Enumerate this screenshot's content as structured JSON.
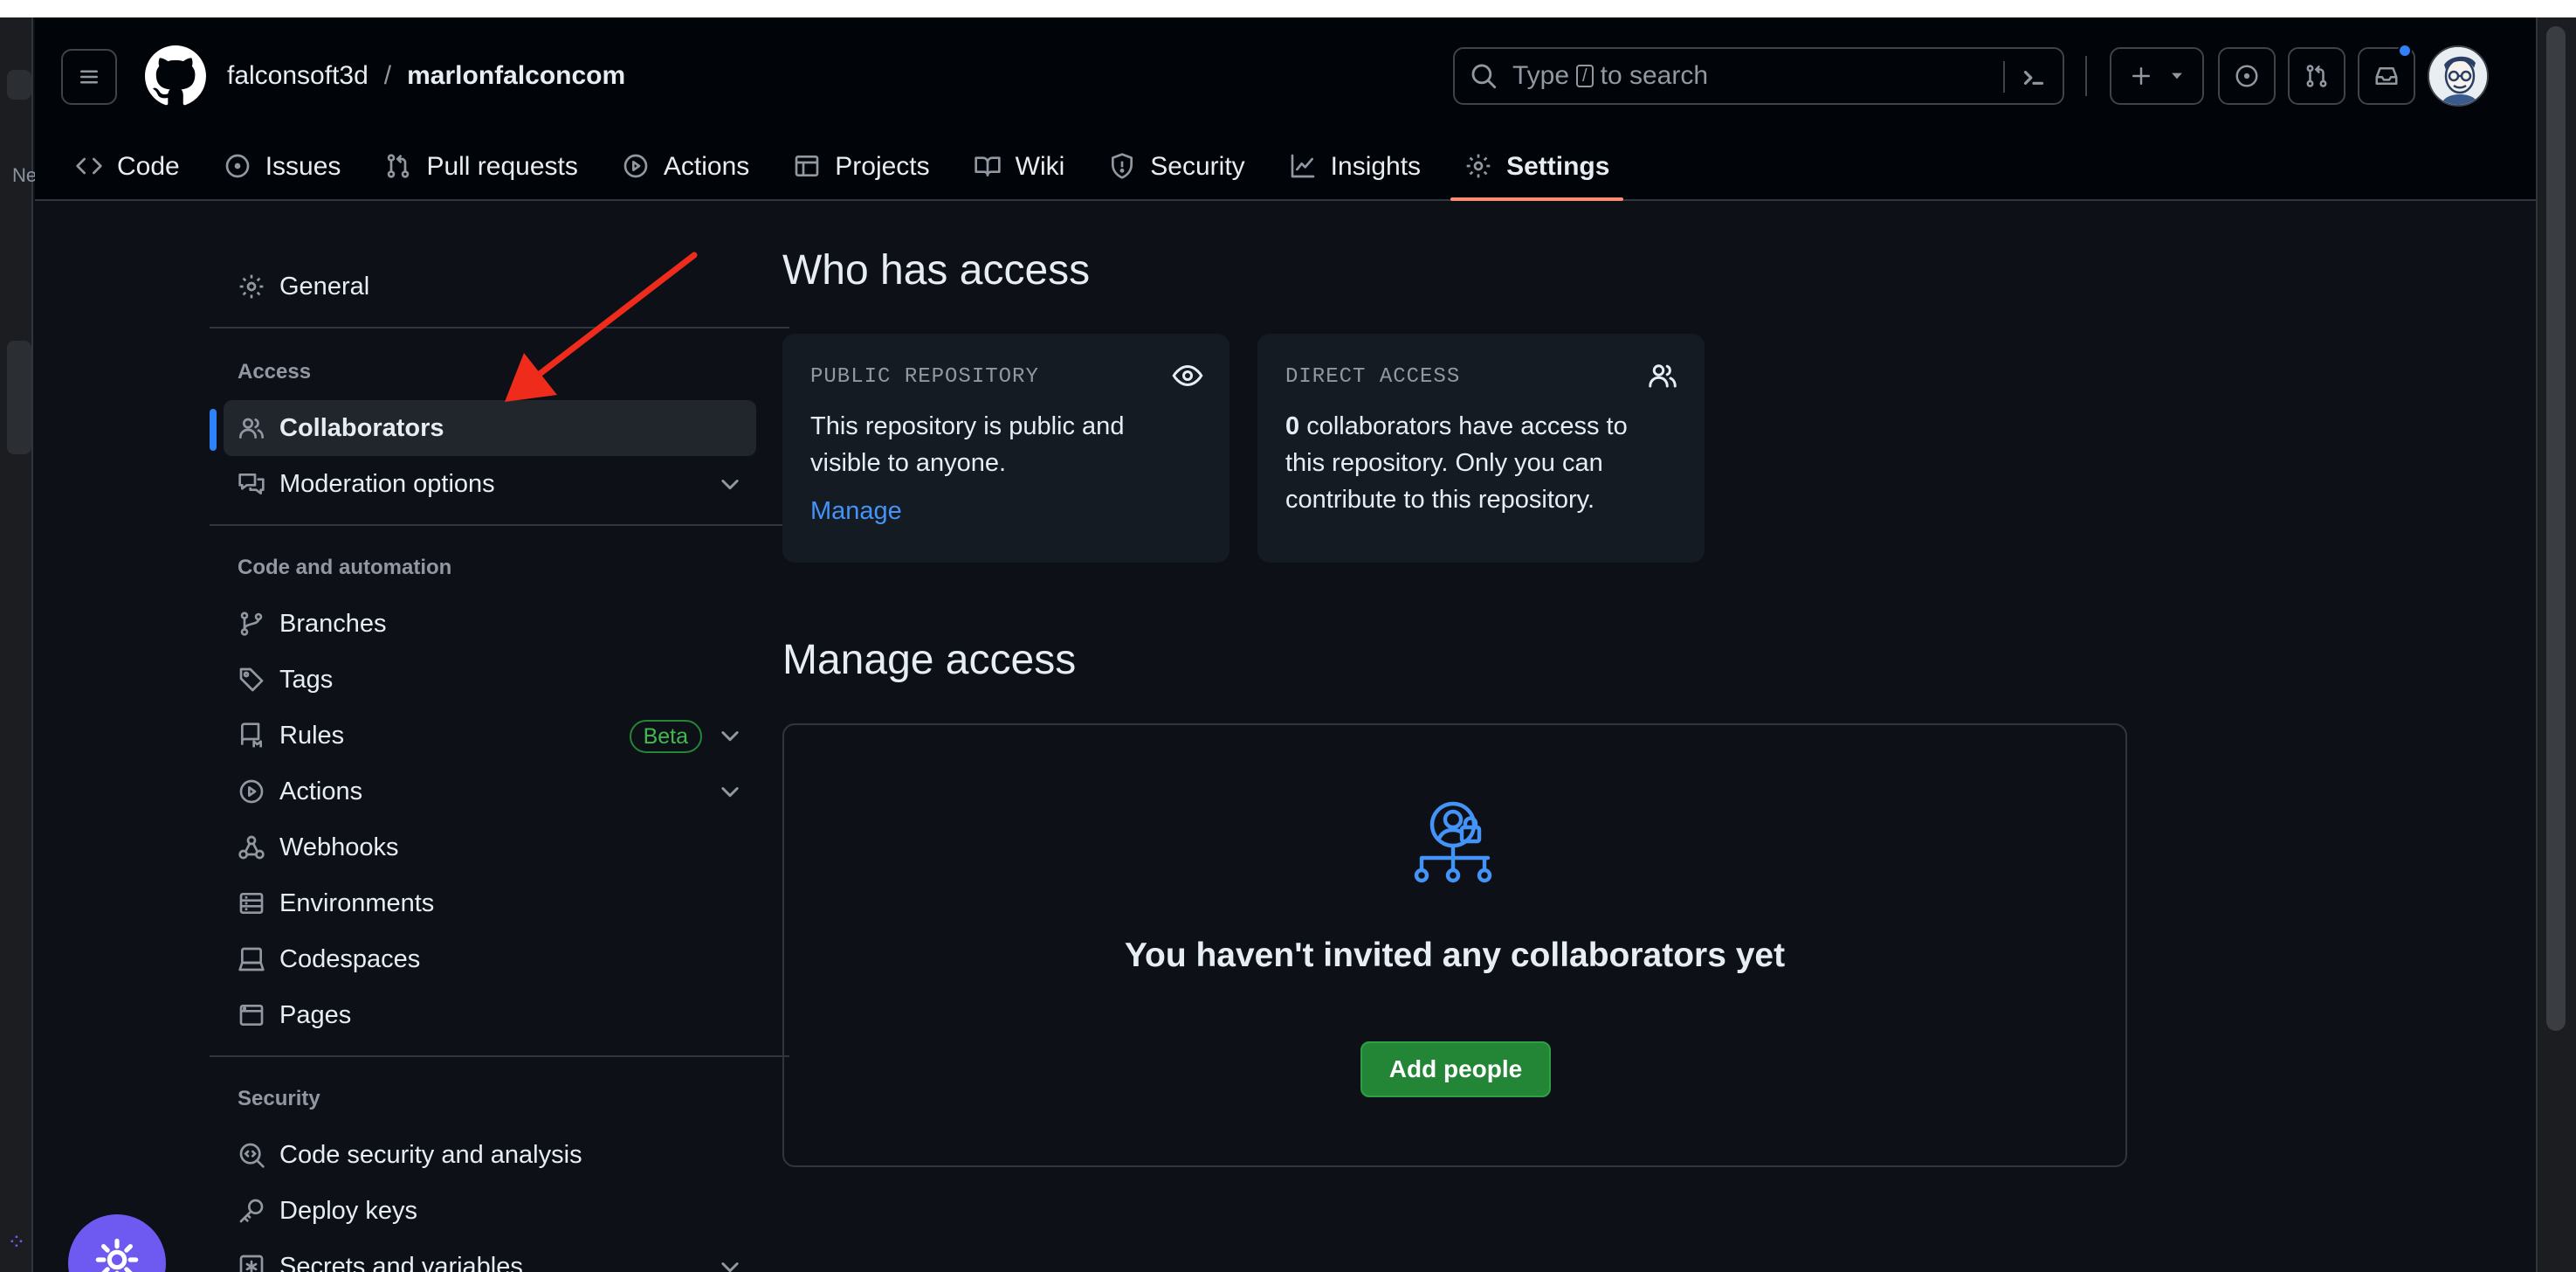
{
  "breadcrumb": {
    "owner": "falconsoft3d",
    "separator": "/",
    "repo": "marlonfalconcom"
  },
  "search": {
    "prefix": "Type",
    "key": "/",
    "suffix": "to search"
  },
  "left_strip": {
    "cut_text": "Ne"
  },
  "repo_nav": {
    "tabs": [
      {
        "label": "Code",
        "icon": "code-icon"
      },
      {
        "label": "Issues",
        "icon": "issue-opened-icon"
      },
      {
        "label": "Pull requests",
        "icon": "git-pull-request-icon"
      },
      {
        "label": "Actions",
        "icon": "play-icon"
      },
      {
        "label": "Projects",
        "icon": "table-icon"
      },
      {
        "label": "Wiki",
        "icon": "book-icon"
      },
      {
        "label": "Security",
        "icon": "shield-icon"
      },
      {
        "label": "Insights",
        "icon": "graph-icon"
      },
      {
        "label": "Settings",
        "icon": "gear-icon",
        "active": true
      }
    ]
  },
  "sidebar": {
    "general": "General",
    "access_heading": "Access",
    "collaborators": "Collaborators",
    "moderation": "Moderation options",
    "code_heading": "Code and automation",
    "branches": "Branches",
    "tags": "Tags",
    "rules": "Rules",
    "rules_badge": "Beta",
    "actions": "Actions",
    "webhooks": "Webhooks",
    "environments": "Environments",
    "codespaces": "Codespaces",
    "pages": "Pages",
    "security_heading": "Security",
    "code_security": "Code security and analysis",
    "deploy_keys": "Deploy keys",
    "secrets": "Secrets and variables"
  },
  "main": {
    "who_title": "Who has access",
    "public_card": {
      "label": "PUBLIC REPOSITORY",
      "desc_line1": "This repository is public and",
      "desc_line2": "visible to anyone.",
      "link": "Manage"
    },
    "direct_card": {
      "label": "DIRECT ACCESS",
      "count": "0",
      "desc_line1_rest": " collaborators have access to",
      "desc_line2": "this repository. Only you can",
      "desc_line3": "contribute to this repository."
    },
    "manage_title": "Manage access",
    "empty_title": "You haven't invited any collaborators yet",
    "add_button": "Add people"
  },
  "colors": {
    "accent_blue": "#2f81f7",
    "link_blue": "#4493f8",
    "active_tab_underline": "#fd8c73",
    "primary_button": "#238636",
    "annotation_arrow": "#ef2b1c",
    "widget_purple": "#6e5af0"
  }
}
